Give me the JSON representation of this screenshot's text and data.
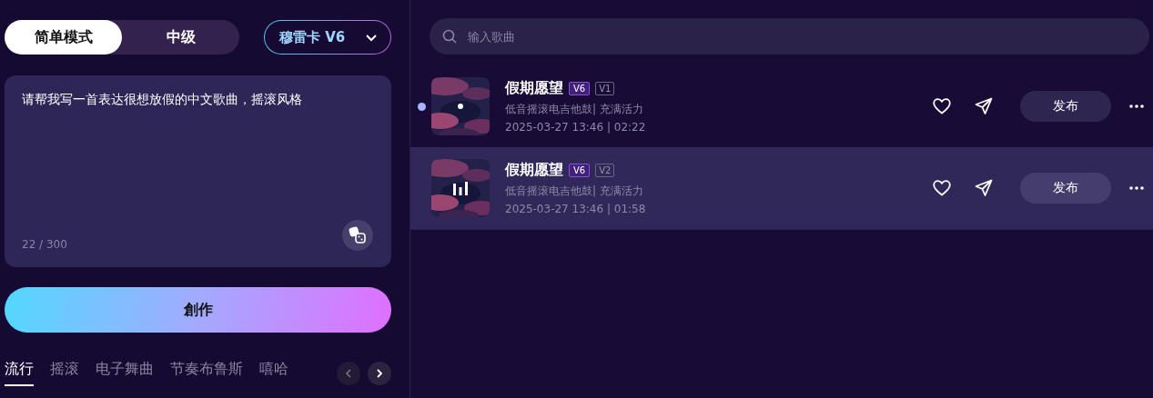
{
  "mode_toggle": [
    {
      "label": "简单模式",
      "selected": true
    },
    {
      "label": "中级",
      "selected": false
    }
  ],
  "model_select": {
    "value": "穆雷卡 V6"
  },
  "prompt": {
    "value": "请帮我写一首表达很想放假的中文歌曲，摇滚风格",
    "counter": "22 / 300"
  },
  "create_button": "創作",
  "genre_tabs": [
    {
      "label": "流行",
      "selected": true
    },
    {
      "label": "摇滚",
      "selected": false
    },
    {
      "label": "电子舞曲",
      "selected": false
    },
    {
      "label": "节奏布鲁斯",
      "selected": false
    },
    {
      "label": "嘻哈",
      "selected": false
    }
  ],
  "search": {
    "placeholder": "输入歌曲"
  },
  "songs": [
    {
      "title": "假期愿望",
      "model": "V6",
      "version": "V1",
      "tags": "低音摇滚电吉他鼓| 充满活力",
      "meta": "2025-03-27 13:46 | 02:22",
      "selected": false,
      "playing": false,
      "unread": true,
      "publish": "发布"
    },
    {
      "title": "假期愿望",
      "model": "V6",
      "version": "V2",
      "tags": "低音摇滚电吉他鼓| 充满活力",
      "meta": "2025-03-27 13:46 | 01:58",
      "selected": true,
      "playing": true,
      "unread": false,
      "publish": "发布"
    }
  ]
}
